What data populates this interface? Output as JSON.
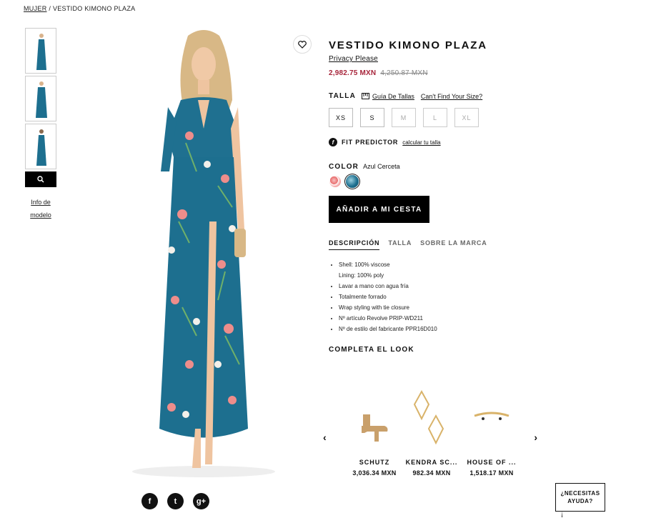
{
  "breadcrumb": {
    "parent": "MUJER",
    "separator": "/",
    "current": "VESTIDO KIMONO PLAZA"
  },
  "thumbnails": {
    "count_label": "",
    "model_info": [
      "Info de",
      "modelo"
    ]
  },
  "product": {
    "title": "VESTIDO KIMONO PLAZA",
    "brand": "Privacy Please",
    "price_now": "2,982.75 MXN",
    "price_old": "4,250.87 MXN"
  },
  "size": {
    "label": "TALLA",
    "guide": "Guía De Tallas",
    "cant_find": "Can't Find Your Size?",
    "options": [
      {
        "label": "XS",
        "available": true
      },
      {
        "label": "S",
        "available": true
      },
      {
        "label": "M",
        "available": false
      },
      {
        "label": "L",
        "available": false
      },
      {
        "label": "XL",
        "available": false
      }
    ]
  },
  "fit": {
    "badge": "f",
    "label": "FIT PREDICTOR",
    "link": "calcular tu talla"
  },
  "color": {
    "label": "COLOR",
    "value": "Azul Cerceta"
  },
  "add_to_cart": "AÑADIR A MI CESTA",
  "tabs": [
    "DESCRIPCIÓN",
    "TALLA",
    "SOBRE LA MARCA"
  ],
  "description": [
    "Shell: 100% viscose",
    "Lining: 100% poly",
    "Lavar a mano con agua fría",
    "Totalmente forrado",
    "Wrap styling with tie closure",
    "Nº artículo Revolve PRIP-WD211",
    "Nº de estilo del fabricante PPR16D010"
  ],
  "complete_look": {
    "title": "COMPLETA EL LOOK",
    "items": [
      {
        "name": "SCHUTZ",
        "price": "3,036.34 MXN"
      },
      {
        "name": "KENDRA SC...",
        "price": "982.34 MXN"
      },
      {
        "name": "HOUSE OF ...",
        "price": "1,518.17 MXN"
      }
    ]
  },
  "social": {
    "facebook": "f",
    "twitter": "t",
    "gplus": "g+"
  },
  "help": [
    "¿NECESITAS",
    "AYUDA?"
  ],
  "colors": {
    "accent_price": "#a7243a",
    "dress": "#1d6f8f"
  }
}
